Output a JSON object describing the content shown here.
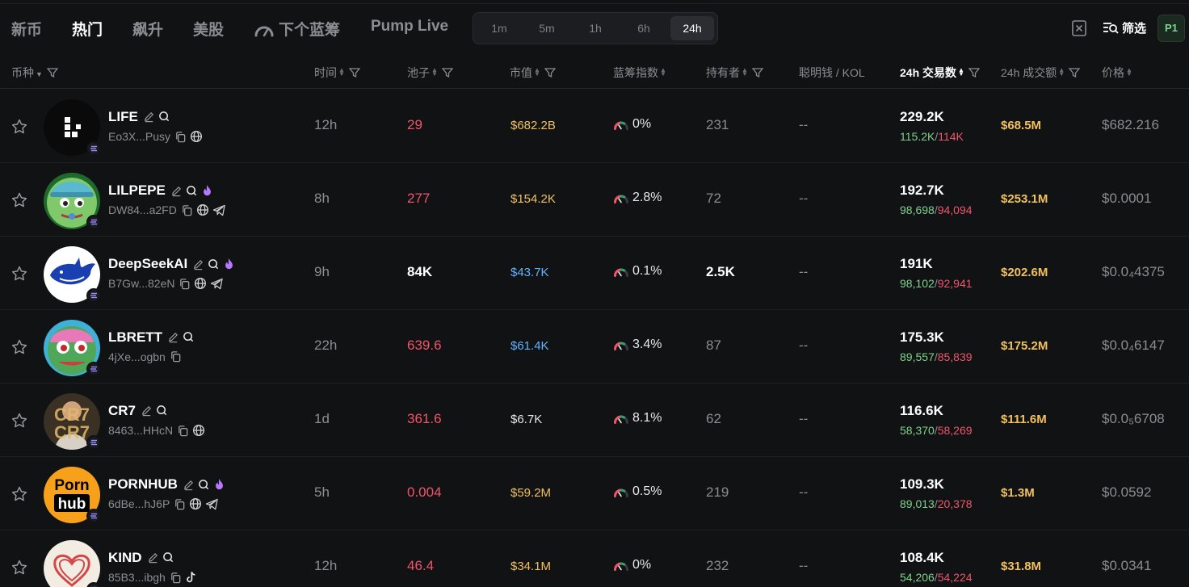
{
  "nav": {
    "tabs": [
      "新币",
      "热门",
      "飙升",
      "美股",
      "下个蓝筹",
      "Pump Live"
    ],
    "active_tab": "热门",
    "timeframes": [
      "1m",
      "5m",
      "1h",
      "6h",
      "24h"
    ],
    "active_timeframe": "24h",
    "filter_label": "筛选",
    "preset_label": "P1"
  },
  "columns": {
    "token": "币种",
    "age": "时间",
    "pool": "池子",
    "mcap": "市值",
    "bluechip": "蓝筹指数",
    "holders": "持有者",
    "smart_kol": "聪明钱 / KOL",
    "txns": "24h 交易数",
    "volume": "24h 成交额",
    "price": "价格"
  },
  "rows": [
    {
      "symbol": "LIFE",
      "address": "Eo3X...Pusy",
      "age": "12h",
      "pool": "29",
      "mcap": "$682.2B",
      "bluechip": "0%",
      "holders": "231",
      "smart_kol": "--",
      "txns": "229.2K",
      "buys": "115.2K",
      "sells": "114K",
      "volume": "$68.5M",
      "price": "$682.216"
    },
    {
      "symbol": "LILPEPE",
      "address": "DW84...a2FD",
      "age": "8h",
      "pool": "277",
      "mcap": "$154.2K",
      "bluechip": "2.8%",
      "holders": "72",
      "smart_kol": "--",
      "txns": "192.7K",
      "buys": "98,698",
      "sells": "94,094",
      "volume": "$253.1M",
      "price": "$0.0001"
    },
    {
      "symbol": "DeepSeekAI",
      "address": "B7Gw...82eN",
      "age": "9h",
      "pool": "84K",
      "mcap": "$43.7K",
      "bluechip": "0.1%",
      "holders": "2.5K",
      "smart_kol": "--",
      "txns": "191K",
      "buys": "98,102",
      "sells": "92,941",
      "volume": "$202.6M",
      "price": "$0.0₄4375"
    },
    {
      "symbol": "LBRETT",
      "address": "4jXe...ogbn",
      "age": "22h",
      "pool": "639.6",
      "mcap": "$61.4K",
      "bluechip": "3.4%",
      "holders": "87",
      "smart_kol": "--",
      "txns": "175.3K",
      "buys": "89,557",
      "sells": "85,839",
      "volume": "$175.2M",
      "price": "$0.0₄6147"
    },
    {
      "symbol": "CR7",
      "address": "8463...HHcN",
      "age": "1d",
      "pool": "361.6",
      "mcap": "$6.7K",
      "bluechip": "8.1%",
      "holders": "62",
      "smart_kol": "--",
      "txns": "116.6K",
      "buys": "58,370",
      "sells": "58,269",
      "volume": "$111.6M",
      "price": "$0.0₅6708"
    },
    {
      "symbol": "PORNHUB",
      "address": "6dBe...hJ6P",
      "age": "5h",
      "pool": "0.004",
      "mcap": "$59.2M",
      "bluechip": "0.5%",
      "holders": "219",
      "smart_kol": "--",
      "txns": "109.3K",
      "buys": "89,013",
      "sells": "20,378",
      "volume": "$1.3M",
      "price": "$0.0592"
    },
    {
      "symbol": "KIND",
      "address": "85B3...ibgh",
      "age": "12h",
      "pool": "46.4",
      "mcap": "$34.1M",
      "bluechip": "0%",
      "holders": "232",
      "smart_kol": "--",
      "txns": "108.4K",
      "buys": "54,206",
      "sells": "54,224",
      "volume": "$31.8M",
      "price": "$0.0341"
    }
  ],
  "avatars": {
    "pornhub_top": "Porn",
    "pornhub_bottom": "hub",
    "cr7_text": "CR7"
  },
  "colors": {
    "background": "#111214",
    "positive": "#7fd38b",
    "negative": "#f0556a",
    "gold": "#f2c15f",
    "blue": "#62b3ff"
  }
}
